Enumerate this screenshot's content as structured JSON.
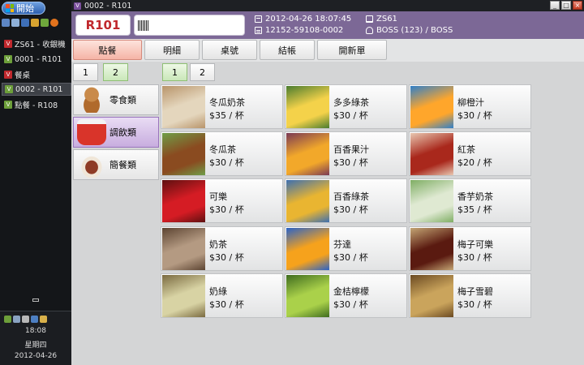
{
  "taskbar": {
    "start_label": "開始",
    "tasks": [
      {
        "label": "ZS61 - 收銀機",
        "icon": "red"
      },
      {
        "label": "0001 - R101",
        "icon": "green"
      },
      {
        "label": "餐桌",
        "icon": "red"
      },
      {
        "label": "0002 - R101",
        "icon": "green",
        "active": true
      },
      {
        "label": "點餐 - R108",
        "icon": "green"
      }
    ],
    "tray": {
      "time": "18:08",
      "weekday": "星期四",
      "date": "2012-04-26"
    }
  },
  "window": {
    "title": "0002 - R101"
  },
  "header": {
    "table_no": "R101",
    "barcode_value": "",
    "datetime": "2012-04-26 18:07:45",
    "order_no": "12152-59108-0002",
    "terminal": "ZS61",
    "user": "BOSS (123) / BOSS"
  },
  "tabs": [
    {
      "label": "點餐",
      "active": true
    },
    {
      "label": "明細"
    },
    {
      "label": "桌號"
    },
    {
      "label": "結帳"
    },
    {
      "label": "開新單"
    }
  ],
  "category_pages": [
    "1",
    "2"
  ],
  "item_pages": [
    "1",
    "2"
  ],
  "categories": [
    {
      "label": "零食類",
      "img": "snack"
    },
    {
      "label": "調飲類",
      "img": "drink",
      "active": true
    },
    {
      "label": "簡餐類",
      "img": "meal"
    }
  ],
  "items": [
    {
      "name": "冬瓜奶茶",
      "price": "$35 / 杯",
      "colors": [
        "#e4d6bd",
        "#b8946a"
      ]
    },
    {
      "name": "多多綠茶",
      "price": "$30 / 杯",
      "colors": [
        "#f4d24a",
        "#4a7c2f"
      ]
    },
    {
      "name": "柳橙汁",
      "price": "$30 / 杯",
      "colors": [
        "#ffa62b",
        "#2f7fc9"
      ]
    },
    {
      "name": "冬瓜茶",
      "price": "$30 / 杯",
      "colors": [
        "#8a4b20",
        "#6f9e48"
      ]
    },
    {
      "name": "百香果汁",
      "price": "$30 / 杯",
      "colors": [
        "#f2a82a",
        "#7a3a55"
      ]
    },
    {
      "name": "紅茶",
      "price": "$20 / 杯",
      "colors": [
        "#a9281c",
        "#e8c7b0"
      ]
    },
    {
      "name": "可樂",
      "price": "$30 / 杯",
      "colors": [
        "#d51c24",
        "#5e1010"
      ]
    },
    {
      "name": "百香綠茶",
      "price": "$30 / 杯",
      "colors": [
        "#e9b531",
        "#3d6fb0"
      ]
    },
    {
      "name": "香芋奶茶",
      "price": "$35 / 杯",
      "colors": [
        "#dfe9d2",
        "#7fae64"
      ]
    },
    {
      "name": "奶茶",
      "price": "$30 / 杯",
      "colors": [
        "#b49a82",
        "#5c4432"
      ]
    },
    {
      "name": "芬達",
      "price": "$30 / 杯",
      "colors": [
        "#f6a21c",
        "#2a63c8"
      ]
    },
    {
      "name": "梅子可樂",
      "price": "$30 / 杯",
      "colors": [
        "#5a1a10",
        "#c4a574"
      ]
    },
    {
      "name": "奶綠",
      "price": "$30 / 杯",
      "colors": [
        "#d8d3a4",
        "#7a6a40"
      ]
    },
    {
      "name": "金桔檸檬",
      "price": "$30 / 杯",
      "colors": [
        "#aad14a",
        "#3f6c1f"
      ]
    },
    {
      "name": "梅子雪碧",
      "price": "$30 / 杯",
      "colors": [
        "#caa45c",
        "#6b4a22"
      ]
    }
  ]
}
